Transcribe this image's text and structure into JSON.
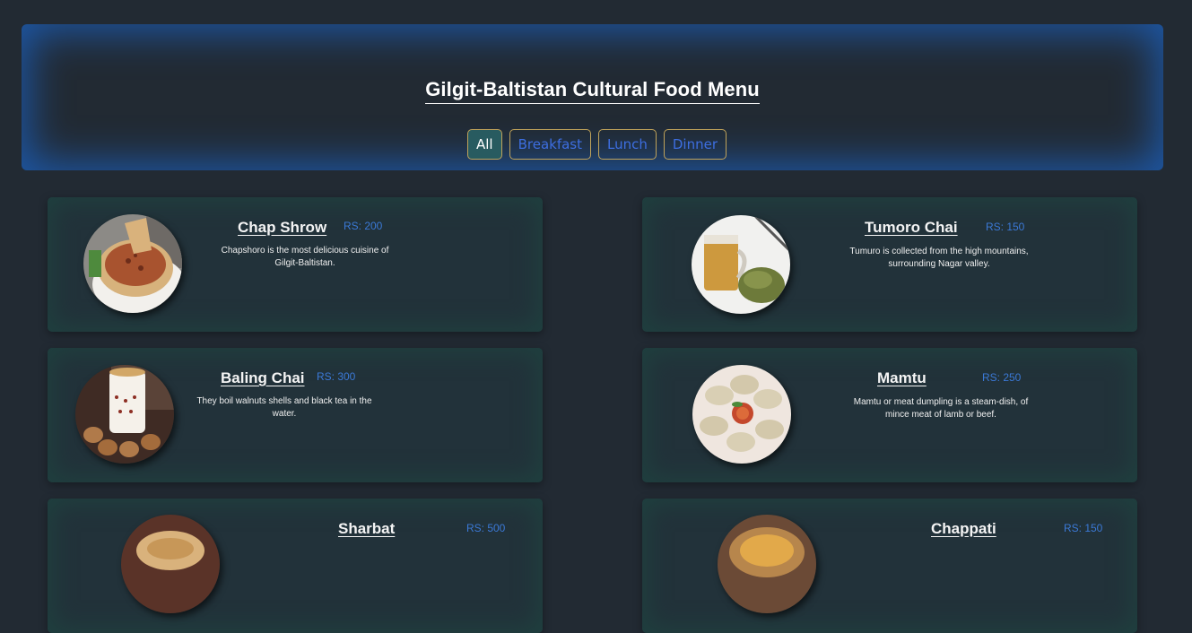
{
  "header": {
    "title": "Gilgit-Baltistan Cultural Food Menu",
    "filters": [
      {
        "label": "All",
        "active": true
      },
      {
        "label": "Breakfast",
        "active": false
      },
      {
        "label": "Lunch",
        "active": false
      },
      {
        "label": "Dinner",
        "active": false
      }
    ]
  },
  "colors": {
    "background": "#222a33",
    "header_glow": "#1d58a8",
    "card_glow": "#1f403f",
    "price": "#3b79d6",
    "filter_text": "#3d6ee0",
    "filter_border": "#c0a35a",
    "filter_active_bg": "#285b60"
  },
  "menu": [
    {
      "name": "Chap Shrow",
      "price": "RS: 200",
      "description": "Chapshoro is the most delicious cuisine of Gilgit-Baltistan.",
      "image": "chap-shrow-photo"
    },
    {
      "name": "Tumoro Chai",
      "price": "RS: 150",
      "description": "Tumuro is collected from the high mountains, surrounding Nagar valley.",
      "image": "tumoro-chai-photo"
    },
    {
      "name": "Baling Chai",
      "price": "RS: 300",
      "description": "They boil walnuts shells and black tea in the water.",
      "image": "baling-chai-photo"
    },
    {
      "name": "Mamtu",
      "price": "RS: 250",
      "description": "Mamtu or meat dumpling is a steam-dish, of mince meat of lamb or beef.",
      "image": "mamtu-photo"
    },
    {
      "name": "Sharbat",
      "price": "RS: 500",
      "description": "",
      "image": "sharbat-photo"
    },
    {
      "name": "Chappati",
      "price": "RS: 150",
      "description": "",
      "image": "chappati-photo"
    }
  ]
}
